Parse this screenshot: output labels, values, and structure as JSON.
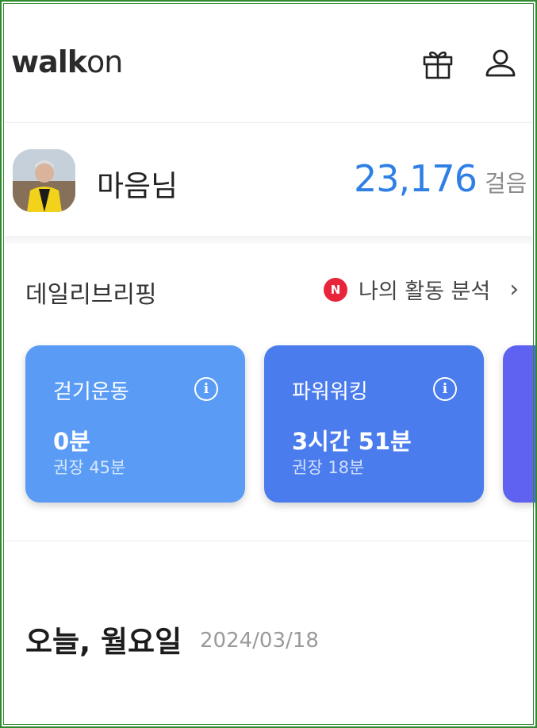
{
  "header": {
    "logo_main": "walk",
    "logo_suffix": "on",
    "icons": [
      "gift-icon",
      "profile-icon"
    ]
  },
  "user": {
    "name": "마음님",
    "steps": "23,176",
    "steps_unit": "걸음"
  },
  "briefing": {
    "title": "데일리브리핑",
    "badge": "N",
    "analysis_label": "나의 활동 분석",
    "chevron": "›"
  },
  "cards": [
    {
      "title": "걷기운동",
      "value": "0분",
      "recommended": "권장 45분",
      "color": "#5a9cf5"
    },
    {
      "title": "파워워킹",
      "value": "3시간 51분",
      "recommended": "권장 18분",
      "color": "#4a7ced"
    }
  ],
  "today": {
    "label": "오늘, 월요일",
    "date": "2024/03/18"
  },
  "colors": {
    "accent": "#2f7fe6",
    "badge": "#e8253a",
    "card3": "#5f61f0"
  }
}
